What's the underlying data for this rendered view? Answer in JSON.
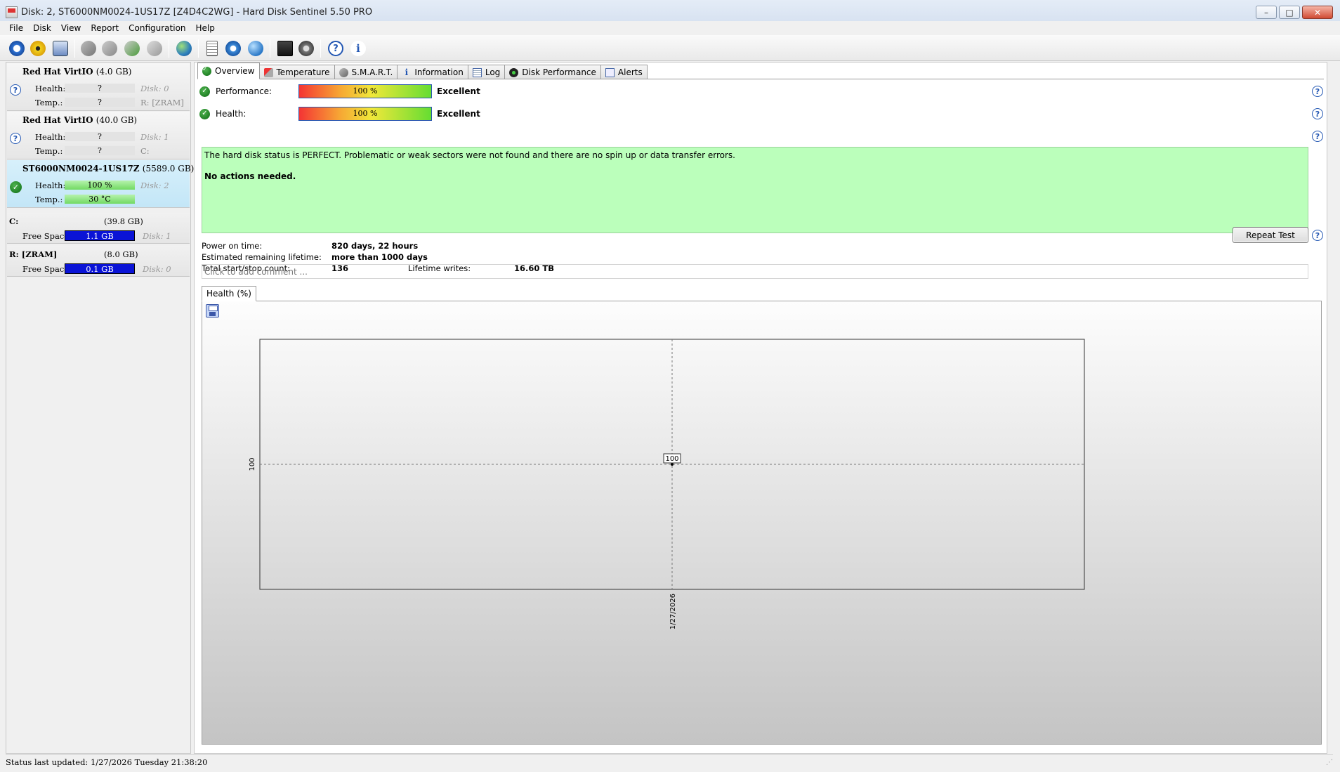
{
  "window": {
    "title": "Disk: 2, ST6000NM0024-1US17Z [Z4D4C2WG]  -  Hard Disk Sentinel 5.50 PRO",
    "buttons": {
      "minimize": "–",
      "maximize": "□",
      "close": "✕"
    }
  },
  "menu": [
    {
      "label": "File"
    },
    {
      "label": "Disk"
    },
    {
      "label": "View"
    },
    {
      "label": "Report"
    },
    {
      "label": "Configuration"
    },
    {
      "label": "Help"
    }
  ],
  "toolbar": {
    "icons": [
      "refresh-icon",
      "alert-icon",
      "disk-icon",
      "test-icon",
      "test-icon",
      "test-icon",
      "test-icon",
      "globe-icon",
      "report-icon",
      "sync-icon",
      "network-icon",
      "chart-icon",
      "sound-icon",
      "help-icon",
      "info-icon"
    ]
  },
  "disks": [
    {
      "name": "Red Hat VirtIO",
      "size": "(4.0 GB)",
      "status": "unknown",
      "health_label": "Health:",
      "health": "?",
      "temp_label": "Temp.:",
      "temp": "?",
      "disk_ref": "Disk: 0",
      "drive_ref": "R: [ZRAM]"
    },
    {
      "name": "Red Hat VirtIO",
      "size": "(40.0 GB)",
      "status": "unknown",
      "health_label": "Health:",
      "health": "?",
      "temp_label": "Temp.:",
      "temp": "?",
      "disk_ref": "Disk: 1",
      "drive_ref": "C:"
    },
    {
      "name": "ST6000NM0024-1US17Z",
      "size": "(5589.0 GB)",
      "status": "ok",
      "health_label": "Health:",
      "health": "100 %",
      "temp_label": "Temp.:",
      "temp": "30 °C",
      "disk_ref": "Disk: 2",
      "drive_ref": ""
    }
  ],
  "volumes": [
    {
      "name": "C:",
      "size": "(39.8 GB)",
      "free_label": "Free Space",
      "free": "1.1 GB",
      "disk_ref": "Disk: 1"
    },
    {
      "name": "R: [ZRAM]",
      "size": "(8.0 GB)",
      "free_label": "Free Space",
      "free": "0.1 GB",
      "disk_ref": "Disk: 0"
    }
  ],
  "tabs": [
    {
      "label": "Overview",
      "active": true
    },
    {
      "label": "Temperature"
    },
    {
      "label": "S.M.A.R.T."
    },
    {
      "label": "Information"
    },
    {
      "label": "Log"
    },
    {
      "label": "Disk Performance"
    },
    {
      "label": "Alerts"
    }
  ],
  "overview": {
    "performance": {
      "label": "Performance:",
      "value": "100 %",
      "rating": "Excellent",
      "percent": 100
    },
    "health": {
      "label": "Health:",
      "value": "100 %",
      "rating": "Excellent",
      "percent": 100
    },
    "status_message": "The hard disk status is PERFECT. Problematic or weak sectors were not found and there are no spin up or data transfer errors.",
    "actions": "No actions needed.",
    "power_on_label": "Power on time:",
    "power_on": "820 days, 22 hours",
    "remaining_label": "Estimated remaining lifetime:",
    "remaining": "more than 1000 days",
    "startstop_label": "Total start/stop count:",
    "startstop": "136",
    "writes_label": "Lifetime writes:",
    "writes": "16.60 TB",
    "repeat_test": "Repeat Test",
    "comment_placeholder": "Click to add comment ...",
    "graph_tab": "Health (%)",
    "help_glyph": "?"
  },
  "chart_data": {
    "type": "line",
    "x": [
      "1/27/2026"
    ],
    "series": [
      {
        "values": [
          100
        ]
      }
    ],
    "y_tick_labels": [
      "100"
    ],
    "x_tick_labels": [
      "1/27/2026"
    ],
    "data_labels": [
      "100"
    ],
    "grid": true
  },
  "statusbar": {
    "text": "Status last updated: 1/27/2026 Tuesday 21:38:20"
  }
}
